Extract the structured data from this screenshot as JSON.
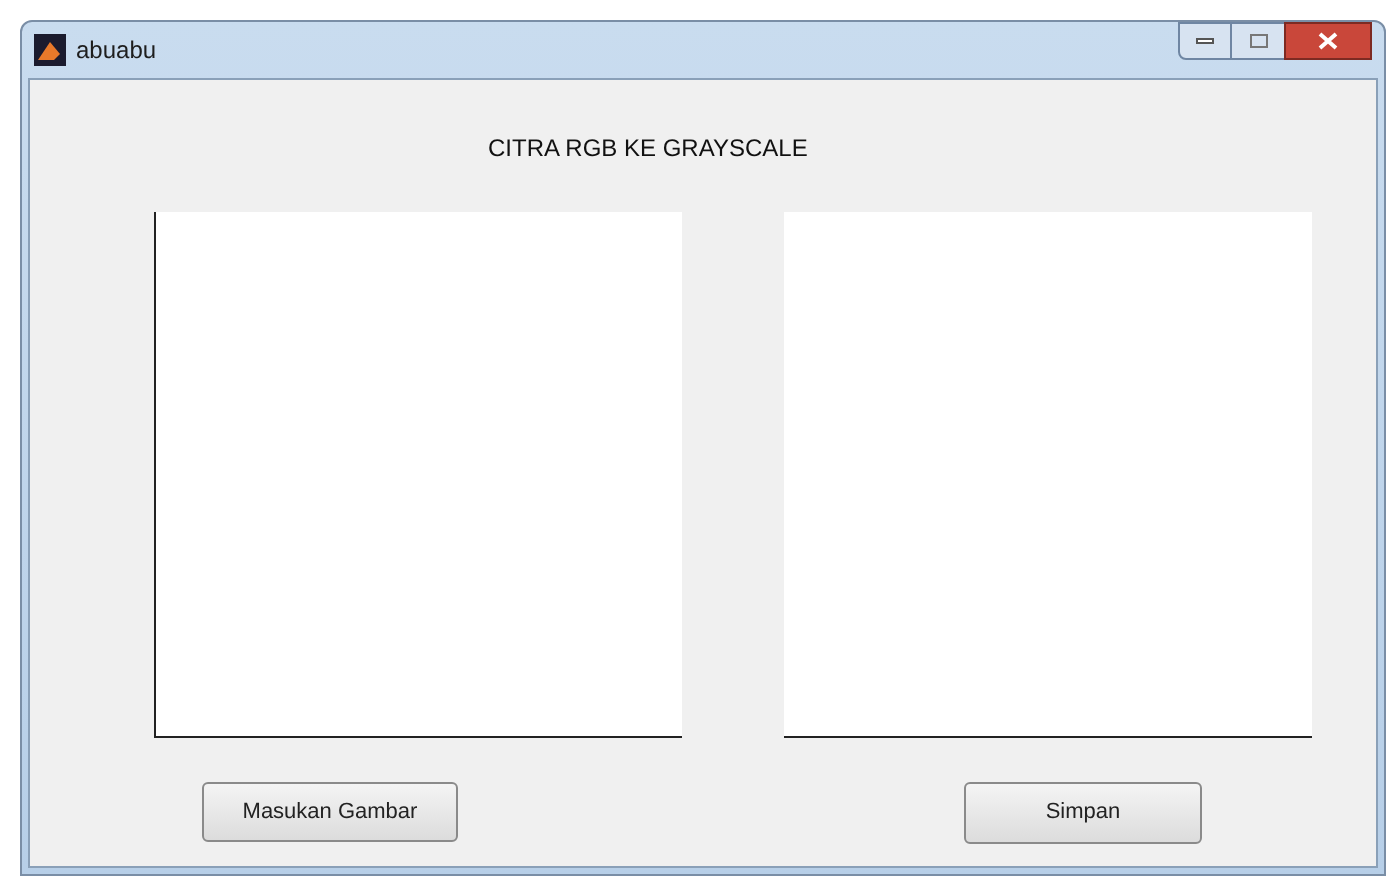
{
  "window": {
    "title": "abuabu"
  },
  "heading": "CITRA RGB KE GRAYSCALE",
  "buttons": [
    {
      "label": "Masukan Gambar"
    },
    {
      "label": "Simpan"
    }
  ]
}
